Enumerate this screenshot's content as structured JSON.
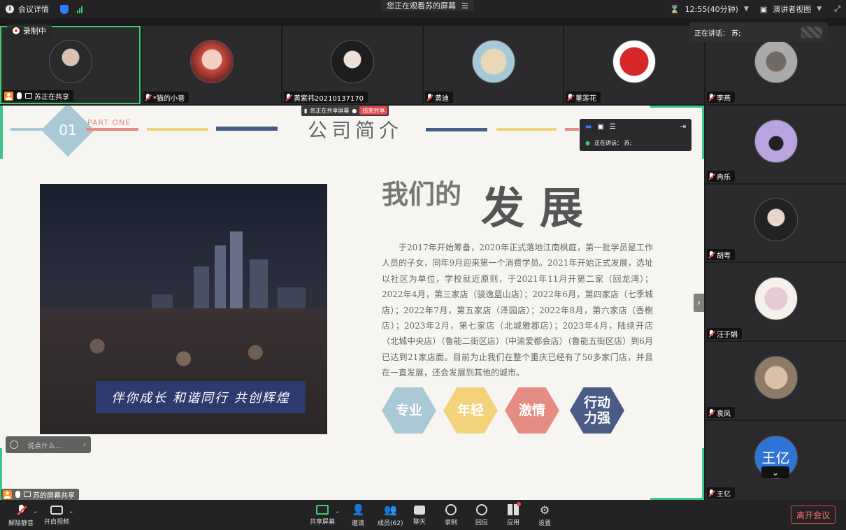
{
  "topbar": {
    "meeting_details": "会议详情",
    "viewing": "您正在观看苏的屏幕",
    "time": "12:55(40分钟)",
    "view_mode": "演讲者视图"
  },
  "recording_label": "录制中",
  "speaking_top": "正在讲话：  苏;",
  "top_tiles": [
    {
      "name": "苏正在共享"
    },
    {
      "name": "*猫的小巷"
    },
    {
      "name": "黄紫祎20210137170"
    },
    {
      "name": "黄迪"
    },
    {
      "name": "董莲花"
    }
  ],
  "side_tiles": [
    {
      "name": "李燕"
    },
    {
      "name": "冉乐"
    },
    {
      "name": "胡粤"
    },
    {
      "name": "汪于娟"
    },
    {
      "name": "袁凤"
    },
    {
      "name": "王亿",
      "avatar_text": "王亿"
    }
  ],
  "share_tag": {
    "text": "您正在共享屏幕",
    "stop": "结束共享"
  },
  "mini_panel": {
    "speaking": "正在讲话：  苏;"
  },
  "slide": {
    "number": "01",
    "part": "PART ONE",
    "title": "公司简介",
    "heading_small": "我们的",
    "heading_big": "发展",
    "paragraph": "于2017年开始筹备，2020年正式落地江南枫庭，第一批学员是工作人员的子女，同年9月迎来第一个消费学员。2021年开始正式发展，选址以社区为单位，学校就近原则，于2021年11月开第二家（回龙湾）；2022年4月，第三家店（骏逸蓝山店）；2022年6月，第四家店（七季城店）；2022年7月，第五家店（泽园店）；2022年8月，第六家店（香榭店）；2023年2月，第七家店（北城雅郡店）；2023年4月，陆续开店（北城中央店）（鲁能二街区店）（中渝爱都会店）（鲁能五街区店）到6月已达到21家店面。目前为止我们在整个重庆已经有了50多家门店，并且在一直发展，还会发展到其他的城市。",
    "photo_banner": "伴你成长 和谐同行 共创辉煌",
    "tags": [
      {
        "label": "专业",
        "color": "#a9c9d6"
      },
      {
        "label": "年轻",
        "color": "#f2d37c"
      },
      {
        "label": "激情",
        "color": "#e58c83"
      },
      {
        "label": "行动\n力强",
        "color": "#4a5c86"
      }
    ]
  },
  "chat": {
    "placeholder": "说点什么..."
  },
  "sharing_label": "苏的屏幕共享",
  "toolbar": {
    "unmute": "解除静音",
    "video": "开启视频",
    "share": "共享屏幕",
    "invite": "邀请",
    "members": "成员(62)",
    "chat": "聊天",
    "record": "录制",
    "react": "回应",
    "apps": "应用",
    "settings": "设置",
    "leave": "离开会议"
  }
}
